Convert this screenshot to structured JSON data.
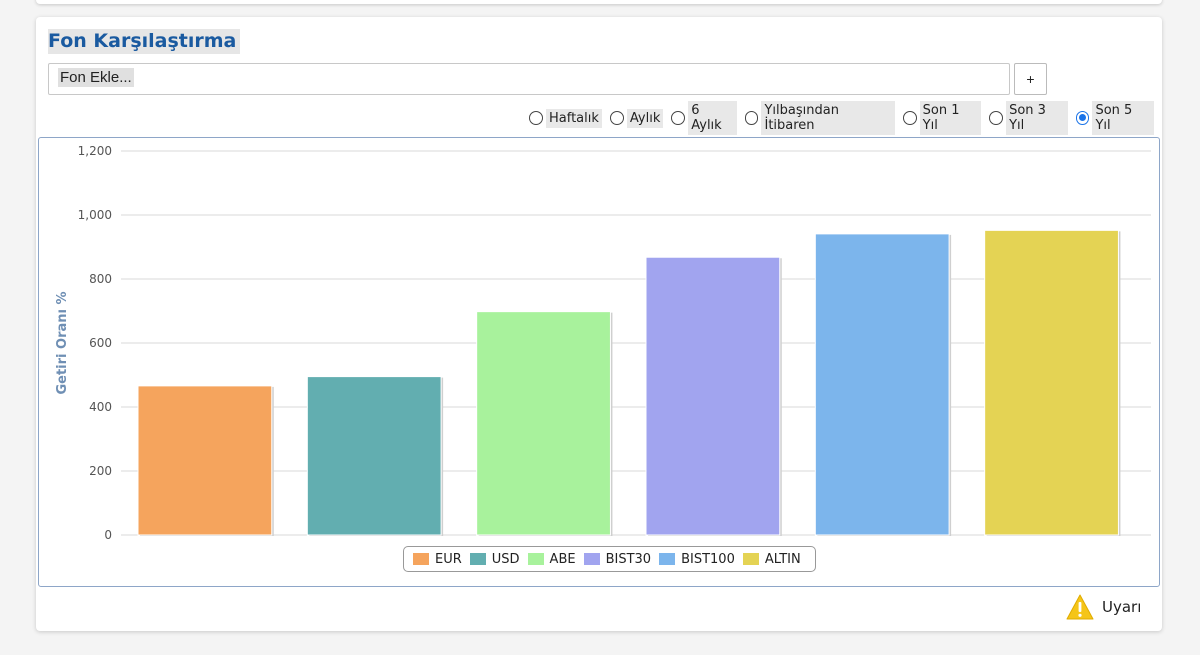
{
  "panel": {
    "title": "Fon Karşılaştırma",
    "fund_input_placeholder": "Fon Ekle...",
    "add_button_label": "+",
    "warning_label": "Uyarı",
    "warning_icon": "warning-triangle-icon"
  },
  "periods": [
    {
      "label": "Haftalık",
      "checked": false
    },
    {
      "label": "Aylık",
      "checked": false
    },
    {
      "label": "6 Aylık",
      "checked": false
    },
    {
      "label": "Yılbaşından İtibaren",
      "checked": false
    },
    {
      "label": "Son 1 Yıl",
      "checked": false
    },
    {
      "label": "Son 3 Yıl",
      "checked": false
    },
    {
      "label": "Son 5 Yıl",
      "checked": true
    }
  ],
  "chart_data": {
    "type": "bar",
    "ylabel": "Getiri Oranı %",
    "ylim": [
      0,
      1200
    ],
    "yticks": [
      "0",
      "200",
      "400",
      "600",
      "800",
      "1,000",
      "1,200"
    ],
    "grid": true,
    "legend_position": "bottom-center",
    "series": [
      {
        "name": "EUR",
        "value": 466,
        "color": "#f5a45d"
      },
      {
        "name": "USD",
        "value": 495,
        "color": "#62aeb0"
      },
      {
        "name": "ABE",
        "value": 698,
        "color": "#a8f29c"
      },
      {
        "name": "BIST30",
        "value": 868,
        "color": "#a1a4ef"
      },
      {
        "name": "BIST100",
        "value": 941,
        "color": "#7cb5ec"
      },
      {
        "name": "ALTIN",
        "value": 952,
        "color": "#e4d354"
      }
    ]
  }
}
